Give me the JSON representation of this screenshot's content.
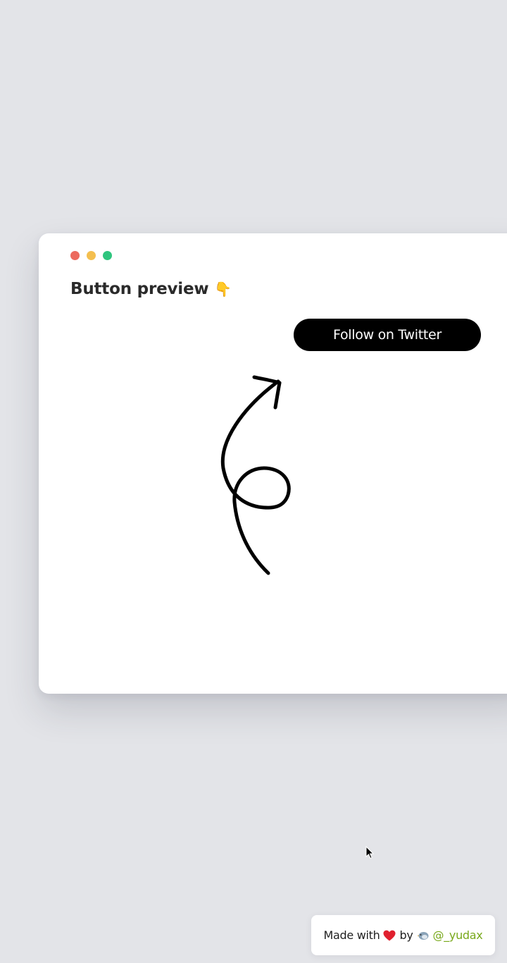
{
  "window": {
    "title": "Button preview",
    "title_emoji": "👇",
    "traffic_lights": {
      "close_color": "#ec6a5e",
      "minimize_color": "#f4bf4f",
      "zoom_color": "#2fc57e"
    }
  },
  "preview": {
    "button_label": "Follow on Twitter",
    "button_bg": "#000000",
    "button_text_color": "#ffffff"
  },
  "footer": {
    "made_with": "Made with",
    "by": "by",
    "handle": "@_yudax",
    "heart_icon": "heart-icon",
    "bird_icon": "bird-icon",
    "handle_color": "#78a81a"
  },
  "colors": {
    "background": "#e3e4e8",
    "window": "#ffffff"
  }
}
